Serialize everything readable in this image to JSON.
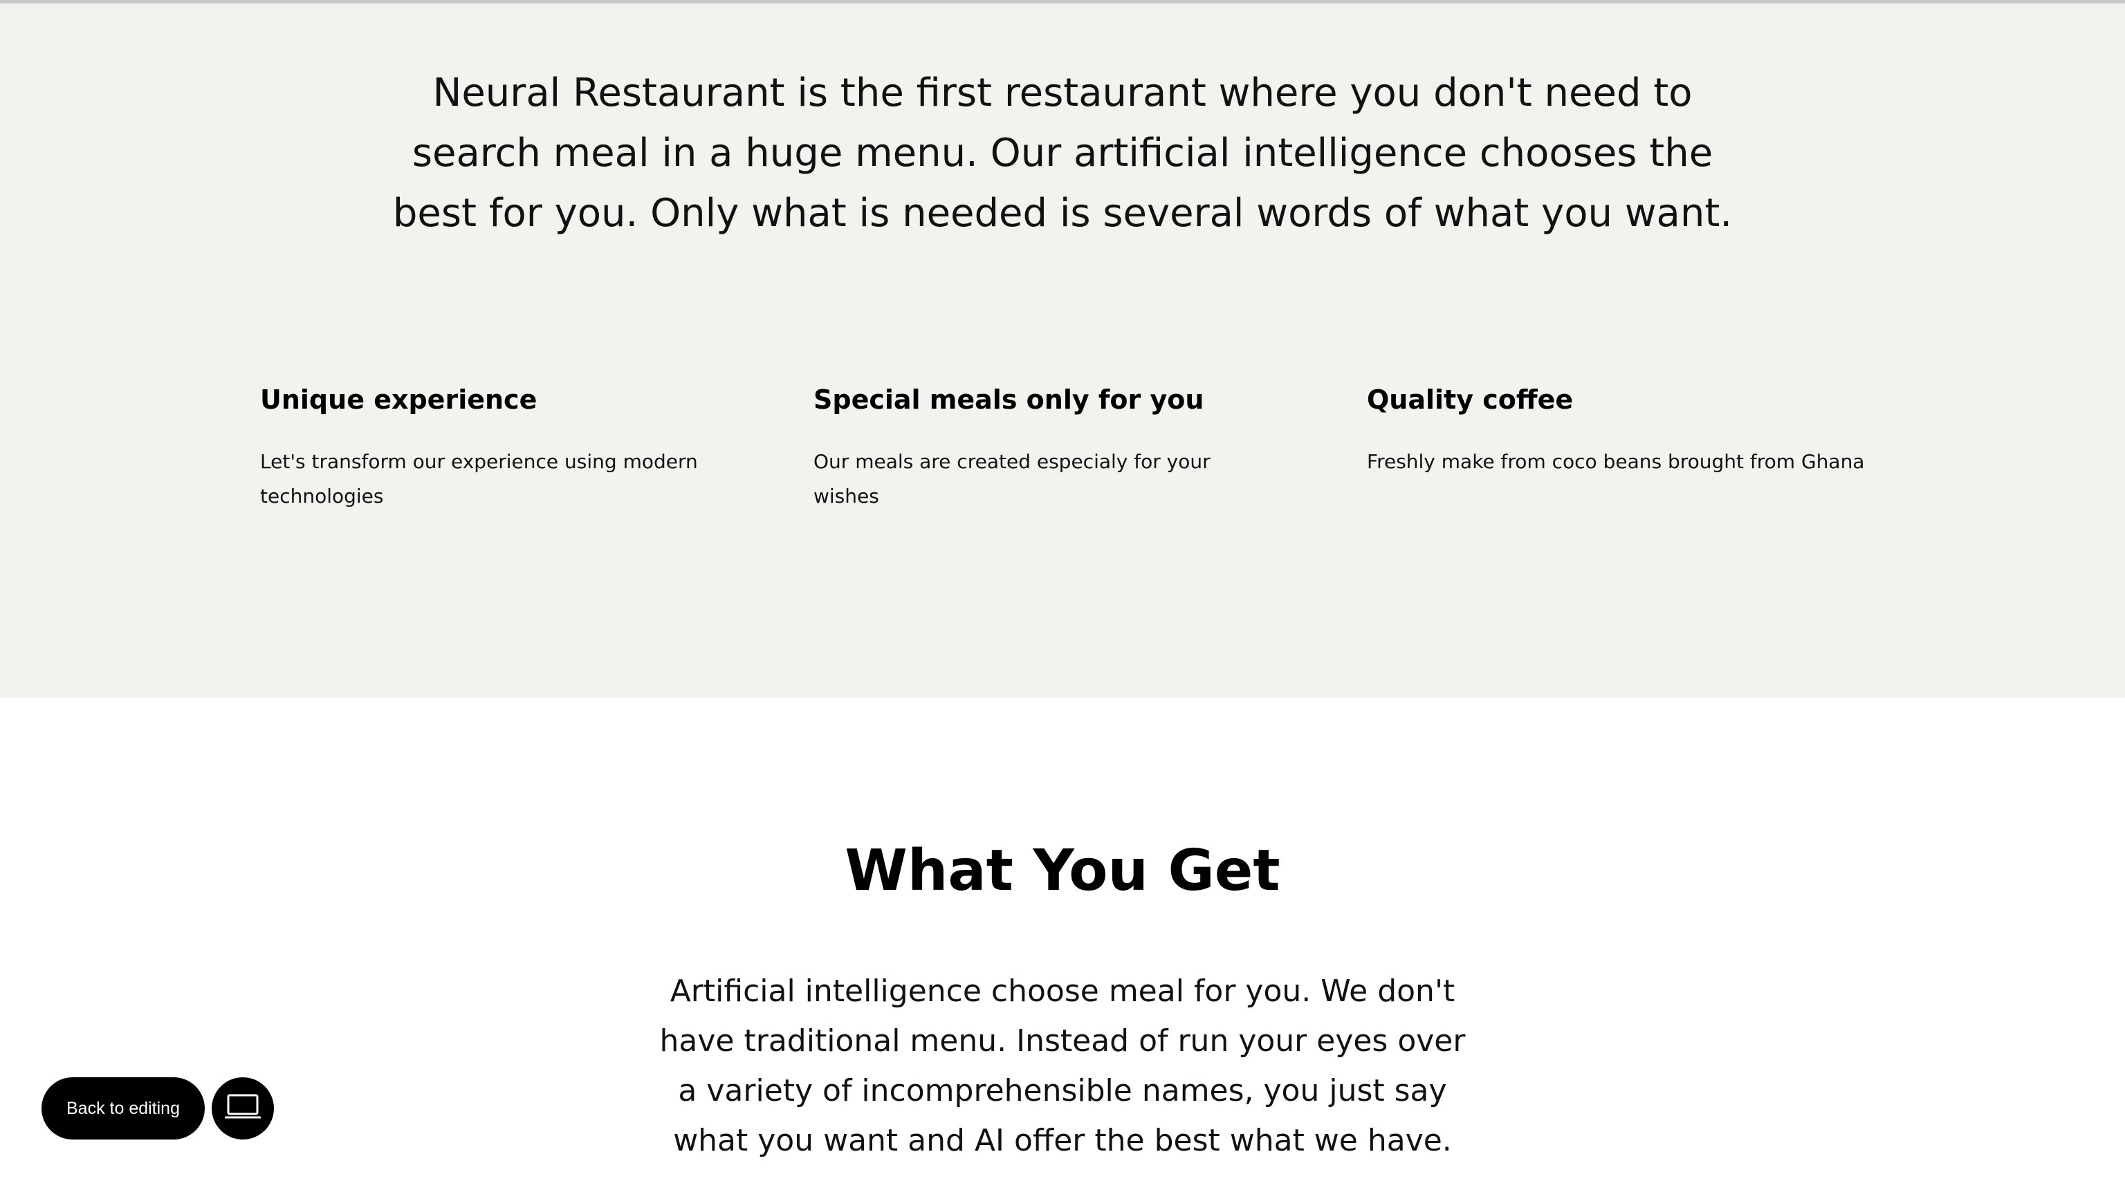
{
  "intro": {
    "text": "Neural Restaurant is the first restaurant where you don't need to search meal in a huge menu. Our artificial intelligence chooses the best for you. Only what is needed is several words of what you want."
  },
  "features": [
    {
      "title": "Unique experience",
      "description": "Let's transform our experience using modern technologies"
    },
    {
      "title": "Special meals only for you",
      "description": "Our meals are created especialy for your wishes"
    },
    {
      "title": "Quality coffee",
      "description": "Freshly make from coco beans brought from Ghana"
    }
  ],
  "what_you_get": {
    "title": "What You Get",
    "text": "Artificial intelligence choose meal for you. We don't have traditional menu. Instead of run your eyes over a variety of incomprehensible names, you just say what you want and AI offer the best what we have."
  },
  "toolbar": {
    "back_label": "Back to editing",
    "device_icon": "laptop-icon"
  }
}
